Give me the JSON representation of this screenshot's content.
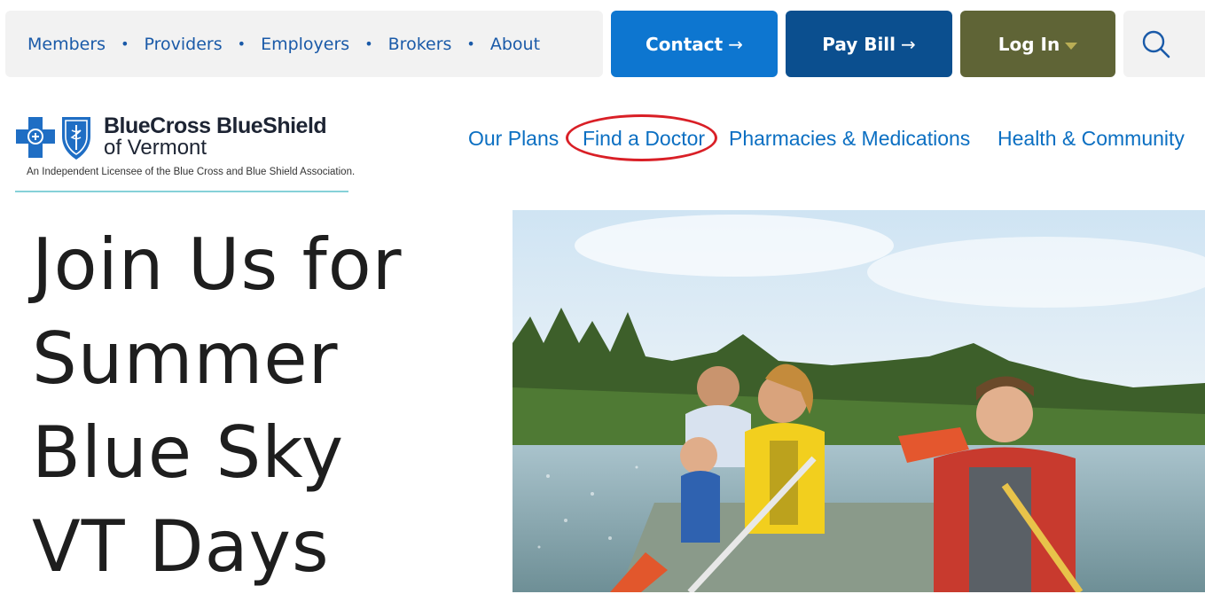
{
  "utility_nav": {
    "items": [
      "Members",
      "Providers",
      "Employers",
      "Brokers",
      "About"
    ]
  },
  "top_buttons": {
    "contact": "Contact",
    "pay_bill": "Pay Bill",
    "log_in": "Log In",
    "arrow": "→"
  },
  "logo": {
    "brand_line1": "BlueCross BlueShield",
    "brand_line2": "of Vermont",
    "tagline": "An Independent Licensee of the Blue Cross and Blue Shield Association."
  },
  "main_nav": {
    "our_plans": "Our Plans",
    "find_doctor": "Find a Doctor",
    "pharmacies": "Pharmacies & Medications",
    "health": "Health & Community"
  },
  "hero": {
    "line1": "Join Us for",
    "line2": "Summer",
    "line3": "Blue Sky",
    "line4": "VT Days"
  },
  "colors": {
    "contact": "#0d76d0",
    "pay_bill": "#0b4f8f",
    "log_in": "#5f6436",
    "link": "#0b6fc2",
    "highlight": "#d91f26"
  },
  "icons": [
    "search-icon",
    "chevron-down-icon",
    "arrow-right-icon",
    "blue-cross-icon",
    "blue-shield-icon"
  ]
}
